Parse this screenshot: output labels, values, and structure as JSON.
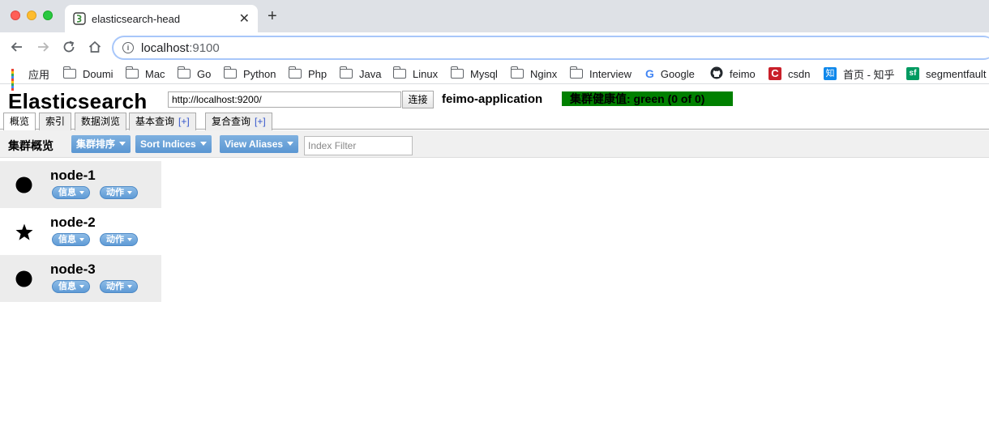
{
  "browser": {
    "tab_title": "elasticsearch-head",
    "new_tab_symbol": "+",
    "close_symbol": "✕",
    "url_host": "localhost",
    "url_port": ":9100",
    "bookmarks": [
      {
        "label": "应用",
        "icon": "apps-grid-icon"
      },
      {
        "label": "Doumi",
        "icon": "folder-icon"
      },
      {
        "label": "Mac",
        "icon": "folder-icon"
      },
      {
        "label": "Go",
        "icon": "folder-icon"
      },
      {
        "label": "Python",
        "icon": "folder-icon"
      },
      {
        "label": "Php",
        "icon": "folder-icon"
      },
      {
        "label": "Java",
        "icon": "folder-icon"
      },
      {
        "label": "Linux",
        "icon": "folder-icon"
      },
      {
        "label": "Mysql",
        "icon": "folder-icon"
      },
      {
        "label": "Nginx",
        "icon": "folder-icon"
      },
      {
        "label": "Interview",
        "icon": "folder-icon"
      },
      {
        "label": "Google",
        "icon": "google-icon"
      },
      {
        "label": "feimo",
        "icon": "github-icon"
      },
      {
        "label": "csdn",
        "icon": "csdn-icon"
      },
      {
        "label": "首页 - 知乎",
        "icon": "zhihu-icon"
      },
      {
        "label": "segmentfault",
        "icon": "segmentfault-icon"
      }
    ]
  },
  "app": {
    "brand": "Elasticsearch",
    "connect_url": "http://localhost:9200/",
    "connect_button": "连接",
    "cluster_name": "feimo-application",
    "cluster_health": "集群健康值: green (0 of 0)",
    "health_color": "#008000",
    "tabs": [
      {
        "label": "概览",
        "plus": ""
      },
      {
        "label": "索引",
        "plus": ""
      },
      {
        "label": "数据浏览",
        "plus": ""
      },
      {
        "label": "基本查询",
        "plus": "[+]"
      },
      {
        "label": "复合查询",
        "plus": "[+]"
      }
    ],
    "section_title": "集群概览",
    "buttons": {
      "sort_cluster": "集群排序",
      "sort_indices": "Sort Indices",
      "view_aliases": "View Aliases"
    },
    "index_filter_placeholder": "Index Filter",
    "nodes": [
      {
        "name": "node-1",
        "marker": "circle",
        "info": "信息",
        "action": "动作"
      },
      {
        "name": "node-2",
        "marker": "star",
        "info": "信息",
        "action": "动作"
      },
      {
        "name": "node-3",
        "marker": "circle",
        "info": "信息",
        "action": "动作"
      }
    ]
  }
}
